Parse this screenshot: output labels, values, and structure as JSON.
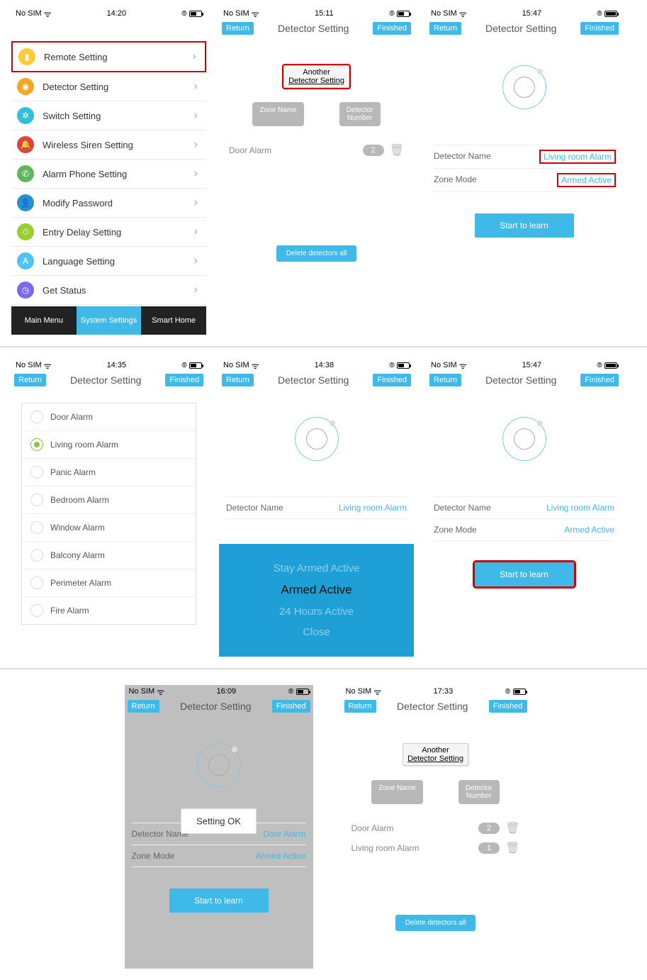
{
  "status": {
    "carrier": "No SIM",
    "wifi": true
  },
  "screens": {
    "s1": {
      "time": "14:20",
      "menu": [
        {
          "label": "Remote Setting",
          "icon_bg": "#ffcc33",
          "icon_glyph": "▮",
          "highlight": true
        },
        {
          "label": "Detector Setting",
          "icon_bg": "#f5a623",
          "icon_glyph": "◉"
        },
        {
          "label": "Switch Setting",
          "icon_bg": "#2ec1d9",
          "icon_glyph": "✲"
        },
        {
          "label": "Wireless Siren Setting",
          "icon_bg": "#e2403f",
          "icon_glyph": "🔔"
        },
        {
          "label": "Alarm Phone Setting",
          "icon_bg": "#5cb85c",
          "icon_glyph": "✆"
        },
        {
          "label": "Modify Password",
          "icon_bg": "#2a8fd0",
          "icon_glyph": "👤"
        },
        {
          "label": "Entry Delay Setting",
          "icon_bg": "#9acd32",
          "icon_glyph": "⏱"
        },
        {
          "label": "Language Setting",
          "icon_bg": "#4fc3f7",
          "icon_glyph": "A"
        },
        {
          "label": "Get Status",
          "icon_bg": "#7b68ee",
          "icon_glyph": "◷"
        }
      ],
      "tabs": [
        {
          "label": "Main Menu"
        },
        {
          "label": "System Settings",
          "active": true
        },
        {
          "label": "Smart Home"
        }
      ]
    },
    "s2": {
      "time": "15:11",
      "return": "Return",
      "title": "Detector Setting",
      "finished": "Finished",
      "popup_line1": "Another",
      "popup_line2": "Detector Setting",
      "zone_name": "Zone Name",
      "detector_number": "Detector Number",
      "rows": [
        {
          "name": "Door Alarm",
          "num": "2"
        }
      ],
      "delete_all": "Delete detectors all"
    },
    "s3": {
      "time": "15:47",
      "return": "Return",
      "title": "Detector Setting",
      "finished": "Finished",
      "fields": [
        {
          "label": "Detector Name",
          "value": "Living room Alarm",
          "red": true
        },
        {
          "label": "Zone Mode",
          "value": "Armed Active",
          "red": true
        }
      ],
      "start_btn": "Start to learn"
    },
    "s4": {
      "time": "14:35",
      "return": "Return",
      "title": "Detector Setting",
      "finished": "Finished",
      "alarms": [
        {
          "label": "Door Alarm"
        },
        {
          "label": "Living room Alarm",
          "selected": true
        },
        {
          "label": "Panic Alarm"
        },
        {
          "label": "Bedroom Alarm"
        },
        {
          "label": "Window Alarm"
        },
        {
          "label": "Balcony Alarm"
        },
        {
          "label": "Perimeter Alarm"
        },
        {
          "label": "Fire Alarm"
        }
      ]
    },
    "s5": {
      "time": "14:38",
      "return": "Return",
      "title": "Detector Setting",
      "finished": "Finished",
      "det_name_label": "Detector Name",
      "det_name_val": "Living room Alarm",
      "picker": [
        "Stay Armed Active",
        "Armed Active",
        "24 Hours Active",
        "Close"
      ],
      "picker_selected": "Armed Active"
    },
    "s6": {
      "time": "15:47",
      "return": "Return",
      "title": "Detector Setting",
      "finished": "Finished",
      "fields": [
        {
          "label": "Detector Name",
          "value": "Living room Alarm"
        },
        {
          "label": "Zone Mode",
          "value": "Armed Active"
        }
      ],
      "start_btn": "Start to learn"
    },
    "s7": {
      "time": "16:09",
      "return": "Return",
      "title": "Detector Setting",
      "finished": "Finished",
      "toast": "Setting OK",
      "fields": [
        {
          "label": "Detector Name",
          "value": "Door Alarm"
        },
        {
          "label": "Zone Mode",
          "value": "Armed Active"
        }
      ],
      "start_btn": "Start to learn"
    },
    "s8": {
      "time": "17:33",
      "return": "Return",
      "title": "Detector Setting",
      "finished": "Finished",
      "popup_line1": "Another",
      "popup_line2": "Detector Setting",
      "zone_name": "Zone Name",
      "detector_number": "Detector Number",
      "rows": [
        {
          "name": "Door Alarm",
          "num": "2"
        },
        {
          "name": "Living room Alarm",
          "num": "1"
        }
      ],
      "delete_all": "Delete detectors all"
    }
  }
}
